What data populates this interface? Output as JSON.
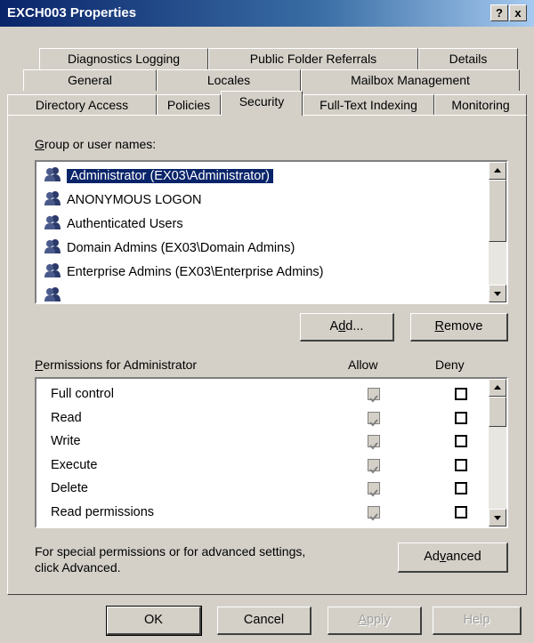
{
  "window": {
    "title": "EXCH003 Properties",
    "help_button": "?",
    "close_button": "x"
  },
  "tabs": {
    "row1": [
      "Diagnostics Logging",
      "Public Folder Referrals",
      "Details"
    ],
    "row2": [
      "General",
      "Locales",
      "Mailbox Management"
    ],
    "row3": [
      "Directory Access",
      "Policies",
      "Security",
      "Full-Text Indexing",
      "Monitoring"
    ],
    "active": "Security"
  },
  "groups": {
    "label_first": "G",
    "label_rest": "roup or user names:",
    "items": [
      {
        "label": "Administrator (EX03\\Administrator)",
        "selected": true
      },
      {
        "label": "ANONYMOUS LOGON",
        "selected": false
      },
      {
        "label": "Authenticated Users",
        "selected": false
      },
      {
        "label": "Domain Admins (EX03\\Domain Admins)",
        "selected": false
      },
      {
        "label": "Enterprise Admins (EX03\\Enterprise Admins)",
        "selected": false
      }
    ]
  },
  "buttons": {
    "add_pre": "A",
    "add_u": "d",
    "add_post": "d...",
    "remove_u": "R",
    "remove_post": "emove",
    "advanced_pre": "Ad",
    "advanced_u": "v",
    "advanced_post": "anced",
    "ok": "OK",
    "cancel": "Cancel",
    "apply_u": "A",
    "apply_post": "pply",
    "help": "Help"
  },
  "permissions": {
    "label_first": "P",
    "label_rest": "ermissions for Administrator",
    "allow_header": "Allow",
    "deny_header": "Deny",
    "rows": [
      {
        "name": "Full control",
        "allow": true,
        "deny": false
      },
      {
        "name": "Read",
        "allow": true,
        "deny": false
      },
      {
        "name": "Write",
        "allow": true,
        "deny": false
      },
      {
        "name": "Execute",
        "allow": true,
        "deny": false
      },
      {
        "name": "Delete",
        "allow": true,
        "deny": false
      },
      {
        "name": "Read permissions",
        "allow": true,
        "deny": false
      }
    ]
  },
  "advanced_note": {
    "line1": "For special permissions or for advanced settings,",
    "line2": "click Advanced."
  },
  "colors": {
    "title_bar": "#0a246a",
    "selection": "#0a246a",
    "face": "#d4d0c8"
  },
  "icons": {
    "user_group": "user-group-icon",
    "scroll_up": "scroll-up-arrow-icon",
    "scroll_down": "scroll-down-arrow-icon",
    "checkmark": "checkmark-icon"
  }
}
